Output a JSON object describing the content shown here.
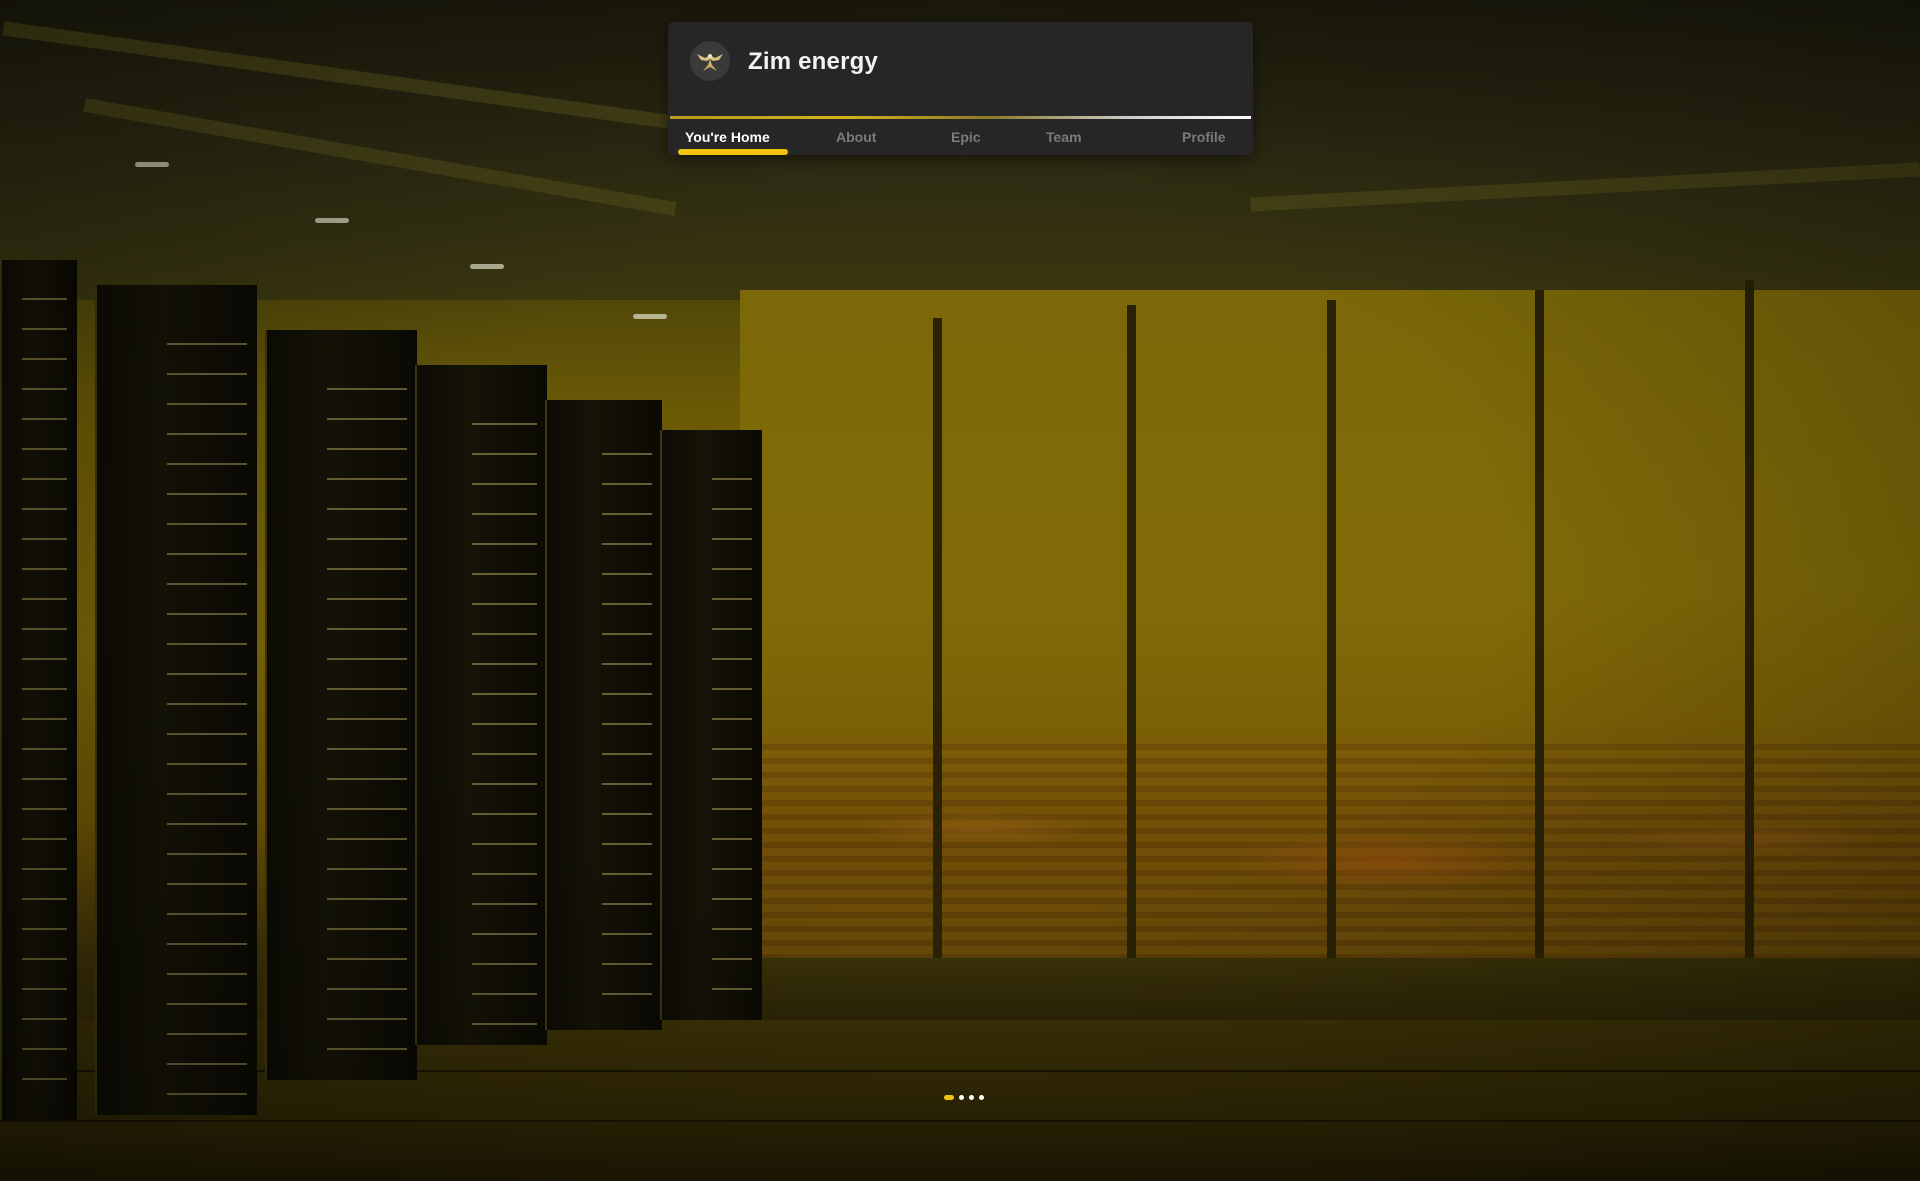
{
  "header": {
    "brand_title": "Zim energy",
    "logo_icon": "eagle-emblem-icon"
  },
  "nav": {
    "tabs": [
      {
        "label": "You're Home",
        "active": true
      },
      {
        "label": "About",
        "active": false
      },
      {
        "label": "Epic",
        "active": false
      },
      {
        "label": "Team",
        "active": false
      },
      {
        "label": "Profile",
        "active": false
      }
    ]
  },
  "pager": {
    "total": 4,
    "active_index": 0
  },
  "colors": {
    "accent": "#f1c40f",
    "card_bg": "#262626",
    "tab_inactive": "#7b7b7b",
    "tab_active": "#ffffff"
  }
}
